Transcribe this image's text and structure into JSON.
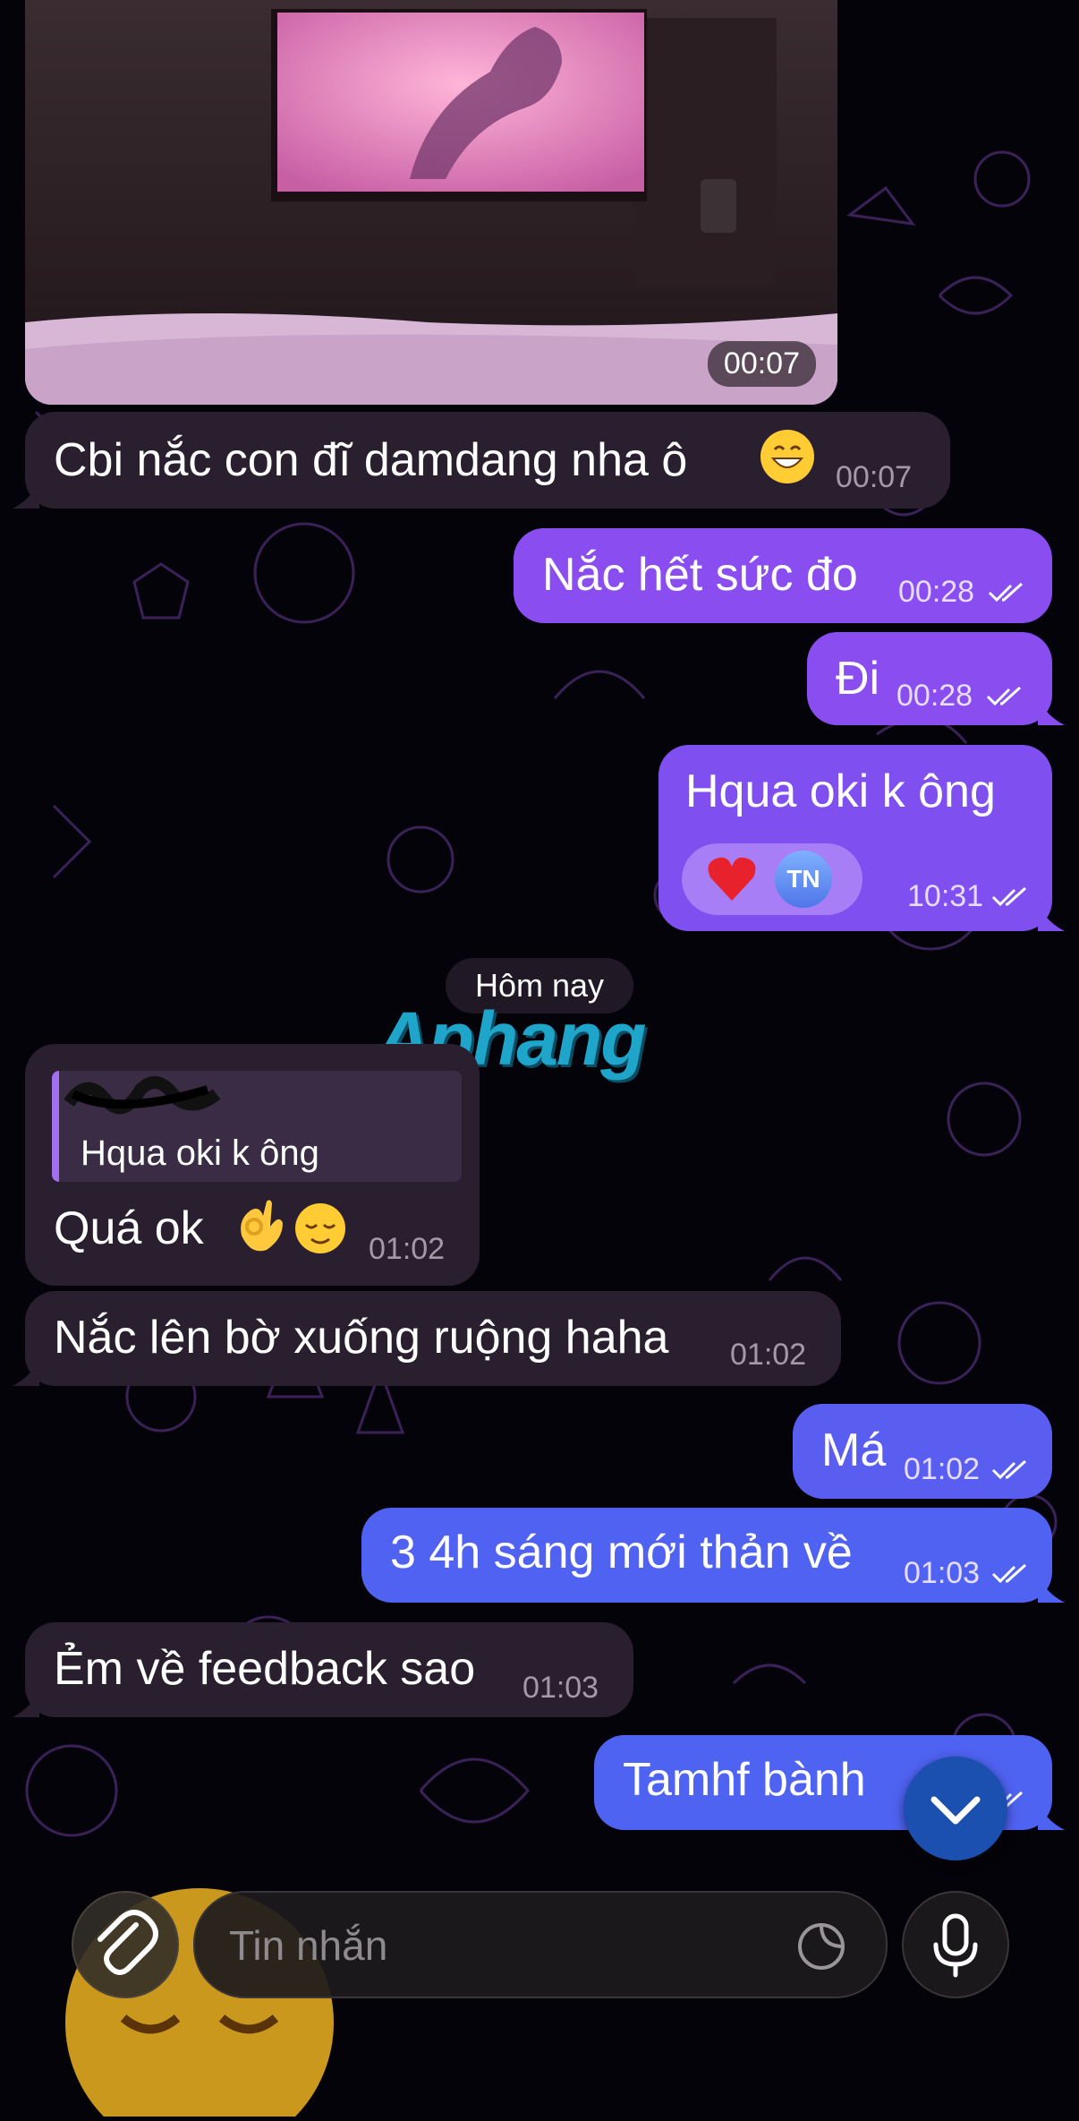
{
  "video": {
    "duration": "00:07"
  },
  "messages": [
    {
      "text": "Cbi nắc con đĩ damdang nha ô",
      "emoji": "grinning-face",
      "time": "00:07"
    },
    {
      "text": "Nắc hết sức đo",
      "time": "00:28"
    },
    {
      "text": "Đi",
      "time": "00:28"
    },
    {
      "text": "Hqua oki k ông",
      "time": "10:31",
      "reaction": {
        "emoji": "red-heart",
        "avatar": "TN"
      }
    },
    {
      "reply_quote": "Hqua oki k ông",
      "text": "Quá ok",
      "emoji": [
        "ok-hand",
        "relieved-face"
      ],
      "time": "01:02"
    },
    {
      "text": "Nắc lên bờ xuống ruộng haha",
      "time": "01:02"
    },
    {
      "text": "Má",
      "time": "01:02"
    },
    {
      "text": "3 4h sáng mới thản về",
      "time": "01:03"
    },
    {
      "text": "Ẻm về feedback sao",
      "time": "01:03"
    },
    {
      "text": "Tamhf bành",
      "time": ""
    }
  ],
  "date_separator": "Hôm nay",
  "watermark": "Aphang",
  "composer": {
    "placeholder": "Tin nhắn"
  },
  "colors": {
    "incoming": "#2a1f2f",
    "outgoing_purple": "#8a4df0",
    "outgoing_blue": "#4f63f2",
    "background": "#05030a"
  }
}
